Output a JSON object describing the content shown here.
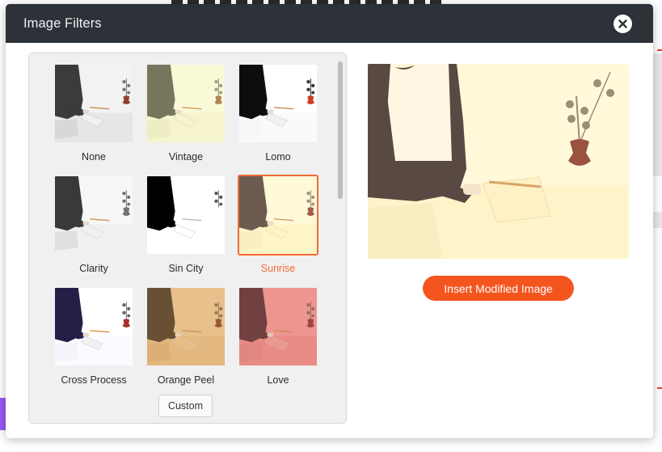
{
  "modal": {
    "title": "Image Filters",
    "close_icon": "close-icon"
  },
  "filters": [
    {
      "label": "None",
      "tint": "#e4e4e4",
      "tint_opacity": 0.0,
      "selected": false
    },
    {
      "label": "Vintage",
      "tint": "#f4f3b0",
      "tint_opacity": 0.55,
      "selected": false
    },
    {
      "label": "Lomo",
      "tint": "#ffffff",
      "tint_opacity": 0.0,
      "selected": false
    },
    {
      "label": "Clarity",
      "tint": "#f2f2f2",
      "tint_opacity": 0.2,
      "selected": false
    },
    {
      "label": "Sin City",
      "tint": "#ffffff",
      "tint_opacity": 0.0,
      "selected": false
    },
    {
      "label": "Sunrise",
      "tint": "#fff2b8",
      "tint_opacity": 0.55,
      "selected": true
    },
    {
      "label": "Cross Process",
      "tint": "#f8f4ff",
      "tint_opacity": 0.1,
      "selected": false
    },
    {
      "label": "Orange Peel",
      "tint": "#e2b77c",
      "tint_opacity": 0.75,
      "selected": false
    },
    {
      "label": "Love",
      "tint": "#e88a86",
      "tint_opacity": 0.7,
      "selected": false
    }
  ],
  "custom_label": "Custom",
  "insert_label": "Insert Modified Image",
  "colors": {
    "accent": "#f4551f",
    "selected_border": "#f06a35",
    "header_bg": "#2c3238"
  }
}
